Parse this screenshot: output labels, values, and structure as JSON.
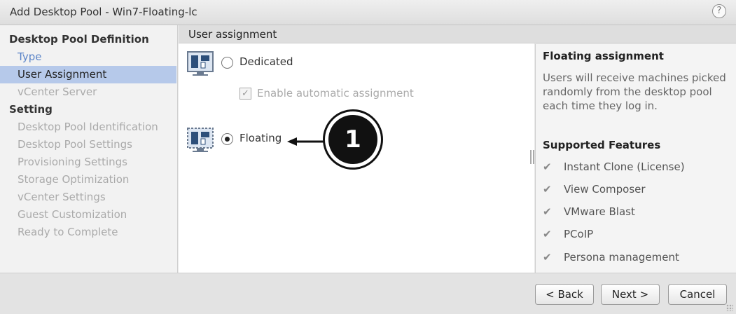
{
  "window": {
    "title": "Add Desktop Pool - Win7-Floating-lc",
    "help_label": "?"
  },
  "nav": {
    "groups": [
      {
        "label": "Desktop Pool Definition"
      },
      {
        "label": "Setting"
      }
    ],
    "steps": [
      {
        "label": "Type"
      },
      {
        "label": "User Assignment"
      },
      {
        "label": "vCenter Server"
      },
      {
        "label": "Desktop Pool Identification"
      },
      {
        "label": "Desktop Pool Settings"
      },
      {
        "label": "Provisioning Settings"
      },
      {
        "label": "Storage Optimization"
      },
      {
        "label": "vCenter Settings"
      },
      {
        "label": "Guest Customization"
      },
      {
        "label": "Ready to Complete"
      }
    ]
  },
  "main": {
    "section_title": "User assignment",
    "options": {
      "dedicated": {
        "label": "Dedicated",
        "selected": false
      },
      "auto_assign": {
        "label": "Enable automatic assignment",
        "checked": true,
        "enabled": false
      },
      "floating": {
        "label": "Floating",
        "selected": true
      }
    },
    "callout_number": "1"
  },
  "info_panel": {
    "title": "Floating assignment",
    "description": "Users will receive machines picked randomly from the desktop pool each time they log in.",
    "features_title": "Supported Features",
    "features": [
      "Instant Clone (License)",
      "View Composer",
      "VMware Blast",
      "PCoIP",
      "Persona management"
    ]
  },
  "footer": {
    "back_label": "< Back",
    "next_label": "Next >",
    "cancel_label": "Cancel"
  },
  "colors": {
    "selected_nav_bg": "#b6c9ea",
    "link_blue": "#5a84c8"
  }
}
